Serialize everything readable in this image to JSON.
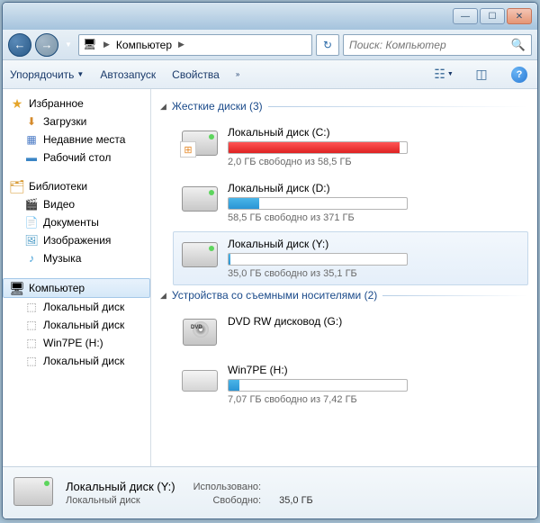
{
  "titlebar": {
    "min": "—",
    "max": "☐",
    "close": "✕"
  },
  "nav": {
    "crumb": "Компьютер",
    "refresh": "↻",
    "search_placeholder": "Поиск: Компьютер"
  },
  "toolbar": {
    "organize": "Упорядочить",
    "autoplay": "Автозапуск",
    "properties": "Свойства"
  },
  "sidebar": {
    "fav": {
      "label": "Избранное",
      "items": [
        {
          "icon": "⬇",
          "color": "#d58a2a",
          "label": "Загрузки"
        },
        {
          "icon": "▦",
          "color": "#4a7ac5",
          "label": "Недавние места"
        },
        {
          "icon": "▬",
          "color": "#3a85c5",
          "label": "Рабочий стол"
        }
      ]
    },
    "lib": {
      "label": "Библиотеки",
      "items": [
        {
          "icon": "🎬",
          "color": "#3a7ac5",
          "label": "Видео"
        },
        {
          "icon": "📄",
          "color": "#d5a54a",
          "label": "Документы"
        },
        {
          "icon": "🖼",
          "color": "#4a9ac5",
          "label": "Изображения"
        },
        {
          "icon": "♪",
          "color": "#3a9ad5",
          "label": "Музыка"
        }
      ]
    },
    "comp": {
      "label": "Компьютер",
      "items": [
        {
          "icon": "⬚",
          "label": "Локальный диск"
        },
        {
          "icon": "⬚",
          "label": "Локальный диск"
        },
        {
          "icon": "⬚",
          "label": "Win7PE (H:)"
        },
        {
          "icon": "⬚",
          "label": "Локальный диск"
        }
      ]
    }
  },
  "content": {
    "hdd_header": "Жесткие диски (3)",
    "rem_header": "Устройства со съемными носителями (2)",
    "drives": [
      {
        "name": "Локальный диск (C:)",
        "status": "2,0 ГБ свободно из 58,5 ГБ",
        "fill": 96,
        "color": "red",
        "type": "hdd",
        "win": true
      },
      {
        "name": "Локальный диск (D:)",
        "status": "58,5 ГБ свободно из 371 ГБ",
        "fill": 17,
        "color": "blue",
        "type": "hdd"
      },
      {
        "name": "Локальный диск (Y:)",
        "status": "35,0 ГБ свободно из 35,1 ГБ",
        "fill": 1,
        "color": "blue",
        "type": "hdd",
        "sel": true
      }
    ],
    "removable": [
      {
        "name": "DVD RW дисковод (G:)",
        "type": "dvd"
      },
      {
        "name": "Win7PE (H:)",
        "status": "7,07 ГБ свободно из 7,42 ГБ",
        "fill": 6,
        "color": "blue",
        "type": "usb"
      }
    ]
  },
  "details": {
    "name": "Локальный диск (Y:)",
    "type": "Локальный диск",
    "used_label": "Использовано:",
    "used_val": "",
    "free_label": "Свободно:",
    "free_val": "35,0 ГБ"
  }
}
